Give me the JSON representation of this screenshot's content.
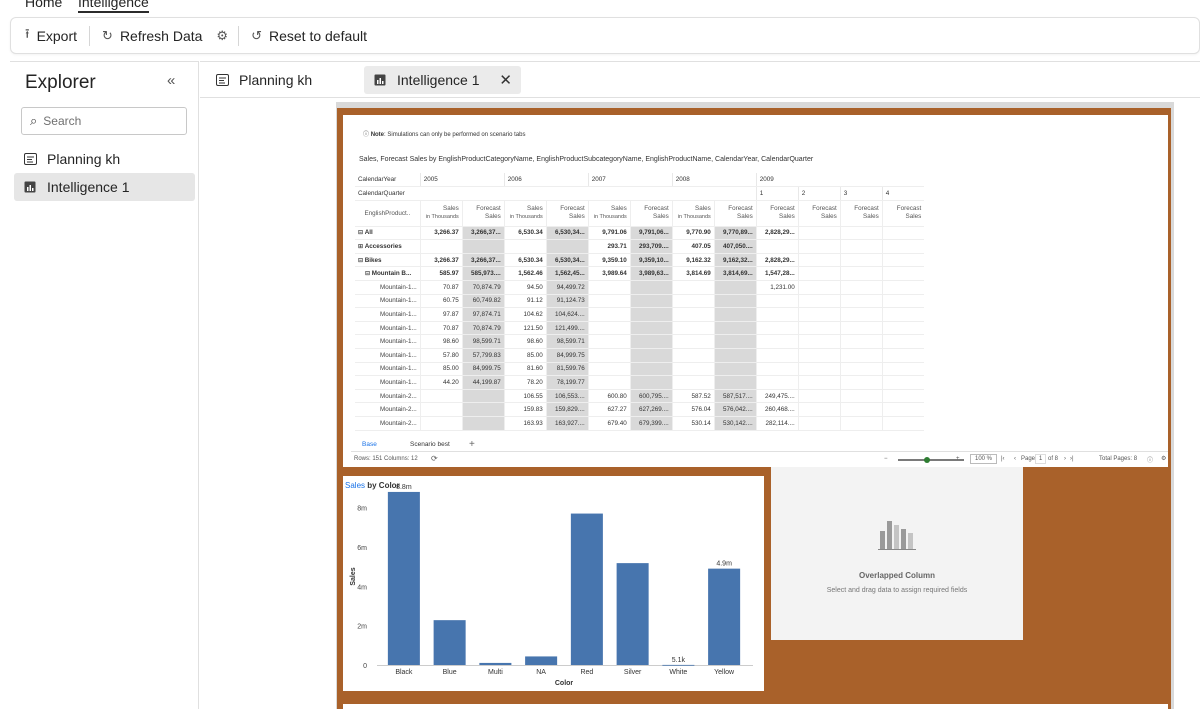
{
  "topnav": {
    "home": "Home",
    "intelligence": "Intelligence"
  },
  "toolbar": {
    "export": "Export",
    "refresh": "Refresh Data",
    "reset": "Reset to default"
  },
  "explorer": {
    "title": "Explorer",
    "search_placeholder": "Search",
    "items": [
      {
        "label": "Planning kh"
      },
      {
        "label": "Intelligence 1"
      }
    ]
  },
  "tabs": [
    {
      "label": "Planning kh"
    },
    {
      "label": "Intelligence 1"
    }
  ],
  "pivot": {
    "note_bold": "Note",
    "note": ": Simulations can only be performed on scenario tabs",
    "title": "Sales, Forecast Sales by EnglishProductCategoryName, EnglishProductSubcategoryName, EnglishProductName, CalendarYear, CalendarQuarter",
    "row_calendar_year": "CalendarYear",
    "row_calendar_quarter": "CalendarQuarter",
    "row_header_label": "EnglishProduct..",
    "years": [
      "2005",
      "2006",
      "2007",
      "2008",
      "2009"
    ],
    "quarters": [
      "1",
      "2",
      "3",
      "4"
    ],
    "measure_sales": [
      "Sales",
      "in Thousands"
    ],
    "measure_forecast": [
      "Forecast",
      "Sales"
    ],
    "rows": [
      {
        "label": "All",
        "prefix": "⊟",
        "bold": true,
        "indent": 0,
        "values": [
          "3,266.37",
          "3,266,37...",
          "6,530.34",
          "6,530,34...",
          "9,791.06",
          "9,791,06...",
          "9,770.90",
          "9,770,89...",
          "2,828,29...",
          "",
          "",
          ""
        ]
      },
      {
        "label": "Accessories",
        "prefix": "⊞",
        "bold": true,
        "indent": 0,
        "values": [
          "",
          "",
          "",
          "",
          "293.71",
          "293,709....",
          "407.05",
          "407,050....",
          "",
          "",
          "",
          ""
        ]
      },
      {
        "label": "Bikes",
        "prefix": "⊟",
        "bold": true,
        "indent": 0,
        "values": [
          "3,266.37",
          "3,266,37...",
          "6,530.34",
          "6,530,34...",
          "9,359.10",
          "9,359,10...",
          "9,162.32",
          "9,162,32...",
          "2,828,29...",
          "",
          "",
          ""
        ]
      },
      {
        "label": "Mountain B...",
        "prefix": "⊟",
        "bold": true,
        "indent": 1,
        "values": [
          "585.97",
          "585,973....",
          "1,562.46",
          "1,562,45...",
          "3,989.64",
          "3,989,63...",
          "3,814.69",
          "3,814,69...",
          "1,547,28...",
          "",
          "",
          ""
        ]
      },
      {
        "label": "Mountain-1...",
        "prefix": "",
        "bold": false,
        "indent": 2,
        "values": [
          "70.87",
          "70,874.79",
          "94.50",
          "94,499.72",
          "",
          "",
          "",
          "",
          "1,231.00",
          "",
          "",
          ""
        ]
      },
      {
        "label": "Mountain-1...",
        "prefix": "",
        "bold": false,
        "indent": 2,
        "values": [
          "60.75",
          "60,749.82",
          "91.12",
          "91,124.73",
          "",
          "",
          "",
          "",
          "",
          "",
          "",
          ""
        ]
      },
      {
        "label": "Mountain-1...",
        "prefix": "",
        "bold": false,
        "indent": 2,
        "values": [
          "97.87",
          "97,874.71",
          "104.62",
          "104,624....",
          "",
          "",
          "",
          "",
          "",
          "",
          "",
          ""
        ]
      },
      {
        "label": "Mountain-1...",
        "prefix": "",
        "bold": false,
        "indent": 2,
        "values": [
          "70.87",
          "70,874.79",
          "121.50",
          "121,499....",
          "",
          "",
          "",
          "",
          "",
          "",
          "",
          ""
        ]
      },
      {
        "label": "Mountain-1...",
        "prefix": "",
        "bold": false,
        "indent": 2,
        "values": [
          "98.60",
          "98,599.71",
          "98.60",
          "98,599.71",
          "",
          "",
          "",
          "",
          "",
          "",
          "",
          ""
        ]
      },
      {
        "label": "Mountain-1...",
        "prefix": "",
        "bold": false,
        "indent": 2,
        "values": [
          "57.80",
          "57,799.83",
          "85.00",
          "84,999.75",
          "",
          "",
          "",
          "",
          "",
          "",
          "",
          ""
        ]
      },
      {
        "label": "Mountain-1...",
        "prefix": "",
        "bold": false,
        "indent": 2,
        "values": [
          "85.00",
          "84,999.75",
          "81.60",
          "81,599.76",
          "",
          "",
          "",
          "",
          "",
          "",
          "",
          ""
        ]
      },
      {
        "label": "Mountain-1...",
        "prefix": "",
        "bold": false,
        "indent": 2,
        "values": [
          "44.20",
          "44,199.87",
          "78.20",
          "78,199.77",
          "",
          "",
          "",
          "",
          "",
          "",
          "",
          ""
        ]
      },
      {
        "label": "Mountain-2...",
        "prefix": "",
        "bold": false,
        "indent": 2,
        "values": [
          "",
          "",
          "106.55",
          "106,553....",
          "600.80",
          "600,795....",
          "587.52",
          "587,517....",
          "249,475....",
          "",
          "",
          ""
        ]
      },
      {
        "label": "Mountain-2...",
        "prefix": "",
        "bold": false,
        "indent": 2,
        "values": [
          "",
          "",
          "159.83",
          "159,829....",
          "627.27",
          "627,269....",
          "576.04",
          "576,042....",
          "260,468....",
          "",
          "",
          ""
        ]
      },
      {
        "label": "Mountain-2...",
        "prefix": "",
        "bold": false,
        "indent": 2,
        "values": [
          "",
          "",
          "163.93",
          "163,927....",
          "679.40",
          "679,399....",
          "530.14",
          "530,142....",
          "282,114....",
          "",
          "",
          ""
        ]
      }
    ],
    "sheet_tabs": [
      "Base",
      "Scenario best"
    ],
    "add_tab": "+",
    "status_left": "Rows: 151  Columns: 12",
    "zoom": "100 %",
    "page_label": "Page",
    "page_value": "1",
    "page_of": "of 8",
    "total_pages": "Total Pages: 8"
  },
  "chart_data": {
    "type": "bar",
    "title_measure": "Sales",
    "title_rest": " by Color",
    "xlabel": "Color",
    "ylabel": "Sales",
    "categories": [
      "Black",
      "Blue",
      "Multi",
      "NA",
      "Red",
      "Silver",
      "White",
      "Yellow"
    ],
    "values": [
      8800000,
      2280000,
      106000,
      436000,
      7700000,
      5180000,
      5100,
      4900000
    ],
    "data_labels": [
      "8.8m",
      "",
      "",
      "",
      "",
      "",
      "5.1k",
      "4.9m"
    ],
    "yticks": [
      {
        "v": 0,
        "label": "0"
      },
      {
        "v": 2000000,
        "label": "2m"
      },
      {
        "v": 4000000,
        "label": "4m"
      },
      {
        "v": 6000000,
        "label": "6m"
      },
      {
        "v": 8000000,
        "label": "8m"
      }
    ],
    "ylim": [
      0,
      9000000
    ],
    "bar_color": "#4775ae",
    "grid": false
  },
  "placeholder": {
    "title": "Overlapped Column",
    "subtitle": "Select and drag data to assign required fields"
  },
  "colors": {
    "frame": "#a9612a",
    "accent": "#1a73e8",
    "forecast_col": "#d9d9d9"
  }
}
